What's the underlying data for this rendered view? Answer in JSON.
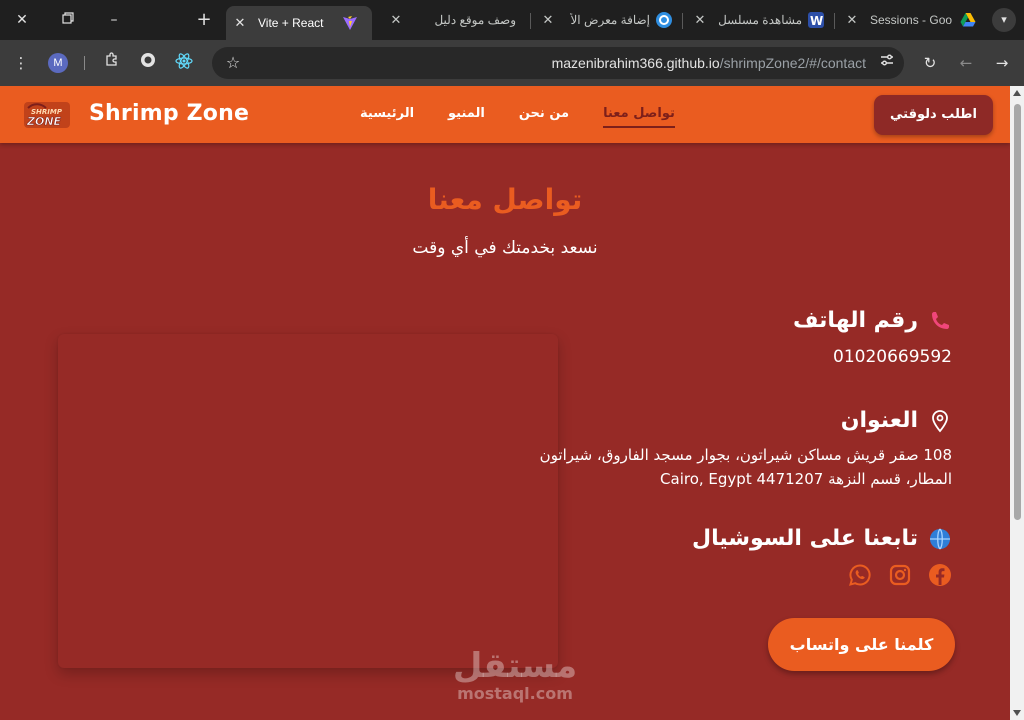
{
  "browser": {
    "tabs": [
      {
        "title": "Sessions - Goo",
        "favicon": "google-drive-icon"
      },
      {
        "title": "مشاهدة مسلسل",
        "favicon": "w-site-icon"
      },
      {
        "title": "إضافة معرض الأ",
        "favicon": "mostaql-icon"
      },
      {
        "title": "وصف موقع دليل",
        "favicon": "generic-icon"
      },
      {
        "title": "Vite + React",
        "favicon": "vite-icon",
        "active": true
      }
    ],
    "new_tab_label": "+",
    "url_host": "mazenibrahim366.github.io",
    "url_path": "/shrimpZone2/#/contact",
    "profile_initial": "M"
  },
  "site": {
    "brand": "Shrimp Zone",
    "logo_text": "SHRIMP ZONE",
    "nav": [
      {
        "label": "الرئيسية",
        "active": false
      },
      {
        "label": "المنيو",
        "active": false
      },
      {
        "label": "من نحن",
        "active": false
      },
      {
        "label": "تواصل معنا",
        "active": true
      }
    ],
    "order_button": "اطلب دلوقتي",
    "colors": {
      "primary": "#ea5c20",
      "background": "#962a26",
      "dark": "#8e2926"
    }
  },
  "contact": {
    "title": "تواصل معنا",
    "subtitle": "نسعد بخدمتك في أي وقت",
    "phone": {
      "heading": "رقم الهاتف",
      "icon": "phone-icon",
      "value": "01020669592"
    },
    "address": {
      "heading": "العنوان",
      "icon": "map-pin-icon",
      "line1": "108 صقر قريش مساكن شيراتون، بجوار مسجد الفاروق، شيراتون",
      "line2": "المطار، قسم النزهة 4471207 Cairo, Egypt"
    },
    "social": {
      "heading": "تابعنا على السوشيال",
      "icon": "globe-icon",
      "links": [
        "facebook-icon",
        "instagram-icon",
        "whatsapp-icon"
      ]
    },
    "whatsapp_button": "كلمنا على واتساب"
  },
  "watermark": {
    "arabic": "مستقل",
    "latin": "mostaql.com"
  }
}
